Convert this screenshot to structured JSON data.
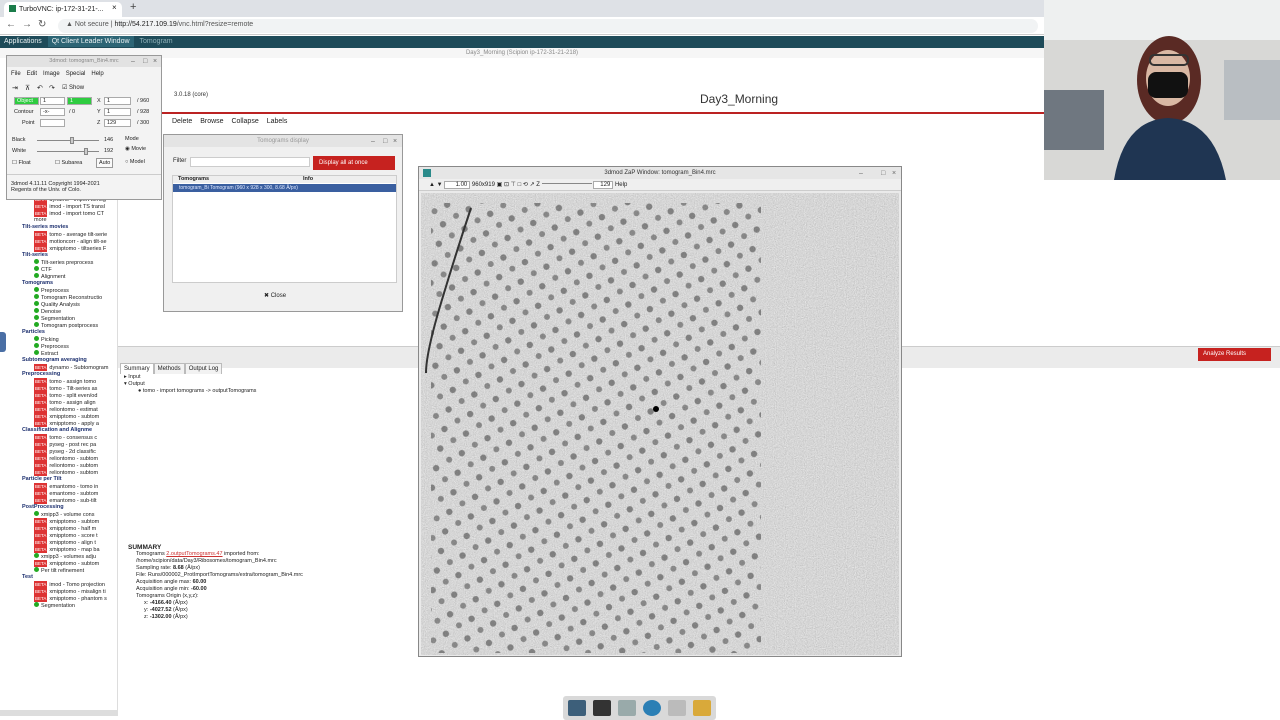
{
  "browser": {
    "tab_title": "TurboVNC: ip-172-31-21-...",
    "new_tab": "+",
    "not_secure": "Not secure",
    "url_host": "http://54.217.109.19",
    "url_path": "/vnc.html?resize=remote"
  },
  "vnc_panel": {
    "applications": "Applications",
    "qt_window": "Qt Client Leader Window",
    "third": "Tomogram"
  },
  "scipion": {
    "window_caption": "Day3_Morning (Scipion ip-172-31-21-218)",
    "project_title": "Day3_Morning",
    "version": "3.0.18 (core)",
    "toolbar": [
      "Delete",
      "Browse",
      "Collapse",
      "Labels"
    ],
    "analyze_button": "Analyze Results",
    "tabs": [
      "Summary",
      "Methods",
      "Output Log"
    ],
    "io_tree": [
      "Input",
      "Output",
      "tomo - import tomograms -> outputTomograms"
    ],
    "summary": {
      "heading": "SUMMARY",
      "line1_prefix": "Tomograms ",
      "line1_link": "2.outputTomograms.47",
      "line1_suffix": " imported from:",
      "line2": "/home/scipion/data/Day3/Ribosomes/tomogram_Bin4.mrc",
      "line3_label": "Sampling rate: ",
      "line3_value": "8.68",
      "line3_unit": " (Å/px)",
      "line4": "File: Runs/000002_ProtImportTomograms/extra/tomogram_Bin4.mrc",
      "line5_label": "Acquisition angle max: ",
      "line5_value": "60.00",
      "line6_label": "Acquisition angle min: ",
      "line6_value": "-60.00",
      "line7": "Tomograms Origin (x,y,z):",
      "x_label": "x: ",
      "x_value": "-4166.40",
      "y_label": "y: ",
      "y_value": "-4027.52",
      "z_label": "z: ",
      "z_value": "-1302.00",
      "unit": " (Å/px)"
    }
  },
  "tree": [
    {
      "type": "beta",
      "text": "dynamo - import tomog"
    },
    {
      "type": "beta",
      "text": "imod - import TS transl"
    },
    {
      "type": "beta",
      "text": "imod - import tomo CT"
    },
    {
      "type": "plain",
      "text": "more"
    },
    {
      "type": "cat",
      "text": "Tilt-series movies"
    },
    {
      "type": "beta",
      "text": "tomo - average tilt-serie"
    },
    {
      "type": "beta",
      "text": "motioncorr - align tilt-se"
    },
    {
      "type": "beta",
      "text": "xmipptomo - tiltseries F"
    },
    {
      "type": "cat",
      "text": "Tilt-series"
    },
    {
      "type": "green",
      "text": "Tilt-series preprocess"
    },
    {
      "type": "green",
      "text": "CTF"
    },
    {
      "type": "green",
      "text": "Alignment"
    },
    {
      "type": "cat",
      "text": "Tomograms"
    },
    {
      "type": "green",
      "text": "Preprocess"
    },
    {
      "type": "green",
      "text": "Tomogram Reconstructio"
    },
    {
      "type": "green",
      "text": "Quality Analysis"
    },
    {
      "type": "green",
      "text": "Denoise"
    },
    {
      "type": "green",
      "text": "Segmentation"
    },
    {
      "type": "green",
      "text": "Tomogram postprocess"
    },
    {
      "type": "cat",
      "text": "Particles"
    },
    {
      "type": "green",
      "text": "Picking"
    },
    {
      "type": "green",
      "text": "Preprocess"
    },
    {
      "type": "green",
      "text": "Extract"
    },
    {
      "type": "cat",
      "text": "Subtomogram averaging"
    },
    {
      "type": "beta",
      "text": "dynamo - Subtomogram"
    },
    {
      "type": "cat",
      "text": "Preprocessing"
    },
    {
      "type": "beta",
      "text": "tomo - assign tomo"
    },
    {
      "type": "beta",
      "text": "tomo - Tilt-series as"
    },
    {
      "type": "beta",
      "text": "tomo - split even/od"
    },
    {
      "type": "beta",
      "text": "tomo - assign align"
    },
    {
      "type": "beta",
      "text": "reliontomo - estimat"
    },
    {
      "type": "beta",
      "text": "xmipptomo - subtom"
    },
    {
      "type": "beta",
      "text": "xmipptomo - apply a"
    },
    {
      "type": "cat",
      "text": "Classification and Alignme"
    },
    {
      "type": "beta",
      "text": "tomo - consensus c"
    },
    {
      "type": "beta",
      "text": "pyseg - post rec pa"
    },
    {
      "type": "beta",
      "text": "pyseg - 2d classific"
    },
    {
      "type": "beta",
      "text": "reliontomo - subtom"
    },
    {
      "type": "beta",
      "text": "reliontomo - subtom"
    },
    {
      "type": "beta",
      "text": "reliontomo - subtom"
    },
    {
      "type": "cat",
      "text": "Particle per Tilt"
    },
    {
      "type": "beta",
      "text": "emantomo - tomo in"
    },
    {
      "type": "beta",
      "text": "emantomo - subtom"
    },
    {
      "type": "beta",
      "text": "emantomo - sub-tilt"
    },
    {
      "type": "cat",
      "text": "PostProcessing"
    },
    {
      "type": "green",
      "text": "xmipp3 - volume cons"
    },
    {
      "type": "beta",
      "text": "xmipptomo - subtom"
    },
    {
      "type": "beta",
      "text": "xmipptomo - half m"
    },
    {
      "type": "beta",
      "text": "xmipptomo - score t"
    },
    {
      "type": "beta",
      "text": "xmipptomo - align t"
    },
    {
      "type": "beta",
      "text": "xmipptomo - map ba"
    },
    {
      "type": "green",
      "text": "xmipp3 - volumes adju"
    },
    {
      "type": "beta",
      "text": "xmipptomo - subtom"
    },
    {
      "type": "green",
      "text": "Per tilt refinement"
    },
    {
      "type": "cat",
      "text": "Test"
    },
    {
      "type": "beta",
      "text": "imod - Tomo projection"
    },
    {
      "type": "beta",
      "text": "xmipptomo - misalign ti"
    },
    {
      "type": "beta",
      "text": "xmipptomo - phantom s"
    },
    {
      "type": "green",
      "text": "Segmentation"
    }
  ],
  "tdmod": {
    "title": "3dmod: tomogram_Bin4.mrc",
    "menu": [
      "File",
      "Edit",
      "Image",
      "Special",
      "Help"
    ],
    "show": "Show",
    "object_label": "Object",
    "object_value": "1",
    "object_count": "1",
    "contour_label": "Contour",
    "contour_value": "-x-",
    "contour_count": "/ 0",
    "point_label": "Point",
    "x_label": "X",
    "x_value": "1",
    "x_max": "/ 960",
    "y_label": "Y",
    "y_value": "1",
    "y_max": "/ 928",
    "z_label": "Z",
    "z_value": "129",
    "z_max": "/ 300",
    "black_label": "Black",
    "black_value": "146",
    "white_label": "White",
    "white_value": "192",
    "mode_label": "Mode",
    "mode_movie": "Movie",
    "mode_model": "Model",
    "float_label": "Float",
    "subarea_label": "Subarea",
    "auto_label": "Auto",
    "copyright1": "3dmod 4.11.11 Copyright 1994-2021",
    "copyright2": "Regents of the Univ. of Colo."
  },
  "tdisp": {
    "title": "Tomograms display",
    "filter_label": "Filter",
    "display_all": "Display all at once",
    "col_tomograms": "Tomograms",
    "col_info": "Info",
    "row": "tomogram_Bi  Tomogram (960 x 928 x 300, 8.68 Å/px)",
    "close": "Close"
  },
  "zap": {
    "title": "3dmod ZaP Window: tomogram_Bin4.mrc",
    "zoom": "1.00",
    "size": "960x919",
    "z_label": "Z",
    "z_value": "129",
    "help": "Help"
  },
  "colors": {
    "scipion_red": "#c6221f",
    "panel_teal": "#1e4b59",
    "object_green": "#2ecc40"
  }
}
